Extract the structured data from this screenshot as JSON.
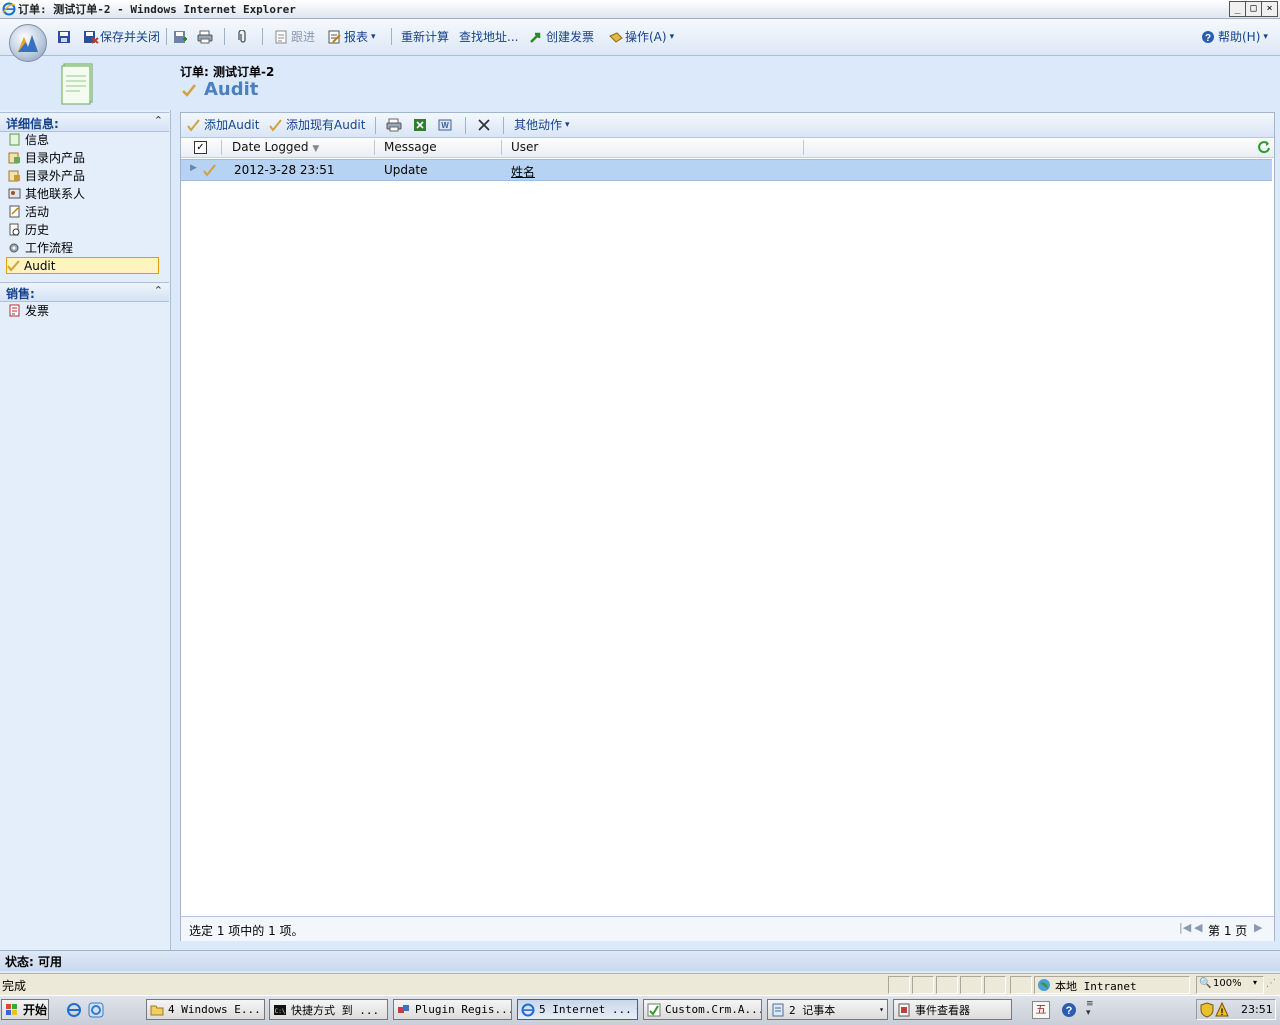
{
  "window": {
    "title": "订单: 测试订单-2 - Windows Internet Explorer",
    "min": "_",
    "max": "□",
    "close": "×"
  },
  "toolbar": {
    "save_close": "保存并关闭",
    "follow": "跟进",
    "reports": "报表",
    "recalc": "重新计算",
    "lookup_address": "查找地址...",
    "create_invoice": "创建发票",
    "actions": "操作(A)",
    "help": "帮助(H)",
    "dropdown": "▾"
  },
  "header": {
    "entity_label": "订单: 测试订单-2",
    "title": "Audit"
  },
  "nav": {
    "details_header": "详细信息:",
    "details_items": [
      {
        "label": "信息"
      },
      {
        "label": "目录内产品"
      },
      {
        "label": "目录外产品"
      },
      {
        "label": "其他联系人"
      },
      {
        "label": "活动"
      },
      {
        "label": "历史"
      },
      {
        "label": "工作流程"
      },
      {
        "label": "Audit"
      }
    ],
    "sales_header": "销售:",
    "sales_items": [
      {
        "label": "发票"
      }
    ],
    "collapse": "≈"
  },
  "grid": {
    "toolbar": {
      "add_new": "添加Audit",
      "add_existing": "添加现有Audit",
      "more_actions": "其他动作"
    },
    "columns": {
      "date": "Date Logged",
      "message": "Message",
      "user": "User"
    },
    "rows": [
      {
        "date": "2012-3-28 23:51",
        "message": "Update",
        "user": "姓名"
      }
    ],
    "footer": {
      "selection": "选定 1 项中的 1 项。",
      "page": "第 1 页"
    }
  },
  "status": {
    "label": "状态: 可用"
  },
  "ie_status": {
    "done": "完成",
    "zone": "本地 Intranet",
    "zoom": "100%"
  },
  "taskbar": {
    "start": "开始",
    "tasks": [
      {
        "label": "4 Windows E..."
      },
      {
        "label": "快捷方式 到 ..."
      },
      {
        "label": "Plugin Regis..."
      },
      {
        "label": "5 Internet ..."
      },
      {
        "label": "Custom.Crm.A..."
      },
      {
        "label": "2 记事本"
      },
      {
        "label": "事件查看器"
      }
    ],
    "clock": "23:51"
  }
}
